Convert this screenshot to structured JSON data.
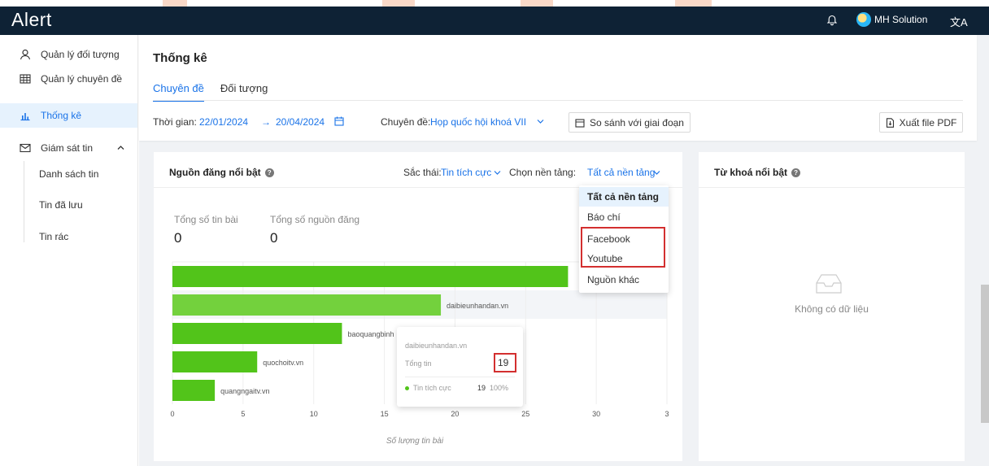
{
  "app": {
    "logo": "Alert",
    "user_name": "MH Solution",
    "translate_glyph": "文A"
  },
  "sidebar": {
    "items": [
      {
        "label": "Quản lý đối tượng",
        "icon": "user-icon"
      },
      {
        "label": "Quản lý chuyên đề",
        "icon": "table-icon"
      },
      {
        "label": "Thống kê",
        "icon": "bar-chart-icon",
        "active": true
      },
      {
        "label": "Giám sát tin",
        "icon": "mail-icon",
        "expanded": true
      }
    ],
    "sub_items": [
      "Danh sách tin",
      "Tin đã lưu",
      "Tin rác"
    ]
  },
  "page": {
    "title": "Thống kê",
    "tabs": [
      {
        "label": "Chuyên đề",
        "active": true
      },
      {
        "label": "Đối tượng",
        "active": false
      }
    ],
    "filters": {
      "time_label": "Thời gian:",
      "date_from": "22/01/2024",
      "arrow": "→",
      "date_to": "20/04/2024",
      "topic_label": "Chuyên đề:",
      "topic_value": "Họp quốc hội khoá VII",
      "compare_button": "So sánh với giai đoạn",
      "export_button": "Xuất file PDF"
    }
  },
  "source_card": {
    "title": "Nguồn đăng nổi bật",
    "sentiment_label": "Sắc thái:",
    "sentiment_value": "Tin tích cực",
    "platform_label": "Chọn nền tảng:",
    "platform_value": "Tất cả nền tảng",
    "total_posts_label": "Tổng số tin bài",
    "total_posts_value": "0",
    "total_sources_label": "Tổng số nguồn đăng",
    "total_sources_value": "0"
  },
  "platform_dropdown": {
    "options": [
      "Tất cả nền tảng",
      "Báo chí",
      "Facebook",
      "Youtube",
      "Nguồn khác"
    ],
    "selected": "Tất cả nền tảng"
  },
  "tooltip": {
    "source": "daibieunhandan.vn",
    "total_label": "Tổng tin",
    "total_value": "19",
    "sentiment_label": "Tin tích cực",
    "sentiment_value": "19",
    "sentiment_pct": "100%"
  },
  "keyword_card": {
    "title": "Từ khoá nổi bật",
    "empty_text": "Không có dữ liệu"
  },
  "colors": {
    "accent": "#1a73e8",
    "topbar": "#0e2235",
    "bar": "#52c41a",
    "bar_highlight": "#73d13d",
    "annotation": "#d32f2f"
  },
  "chart_data": {
    "type": "bar",
    "orientation": "horizontal",
    "categories": [
      "",
      "daibieunhandan.vn",
      "baoquangbinh",
      "quochoitv.vn",
      "quangngaitv.vn"
    ],
    "values": [
      28,
      19,
      12,
      6,
      3
    ],
    "xlabel": "Số lượng tin bài",
    "xlim": [
      0,
      35
    ],
    "xticks": [
      "0",
      "5",
      "10",
      "15",
      "20",
      "25",
      "30",
      "3"
    ],
    "grid": true
  }
}
